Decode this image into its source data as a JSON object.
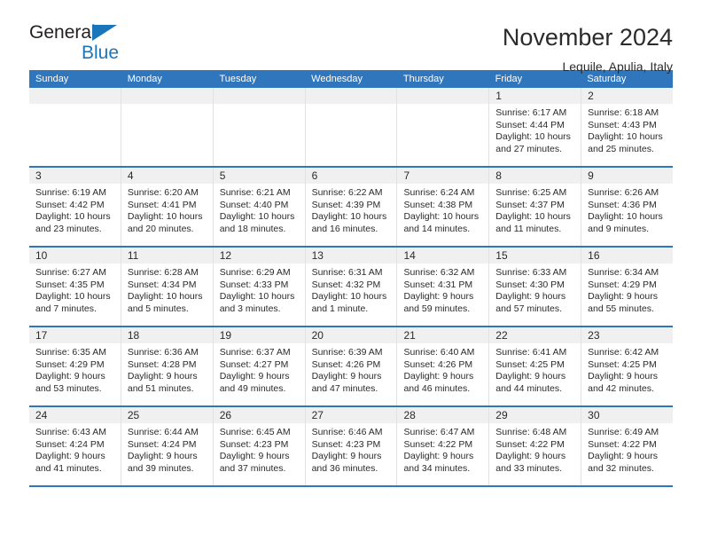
{
  "brand": {
    "name_part1": "General",
    "name_part2": "Blue",
    "accent_color": "#1b75bb"
  },
  "header": {
    "title": "November 2024",
    "location": "Lequile, Apulia, Italy"
  },
  "calendar": {
    "header_bg": "#2f76bc",
    "weekdays": [
      "Sunday",
      "Monday",
      "Tuesday",
      "Wednesday",
      "Thursday",
      "Friday",
      "Saturday"
    ],
    "weeks": [
      [
        {
          "day": "",
          "empty": true
        },
        {
          "day": "",
          "empty": true
        },
        {
          "day": "",
          "empty": true
        },
        {
          "day": "",
          "empty": true
        },
        {
          "day": "",
          "empty": true
        },
        {
          "day": "1",
          "sunrise": "Sunrise: 6:17 AM",
          "sunset": "Sunset: 4:44 PM",
          "daylight_line1": "Daylight: 10 hours",
          "daylight_line2": "and 27 minutes."
        },
        {
          "day": "2",
          "sunrise": "Sunrise: 6:18 AM",
          "sunset": "Sunset: 4:43 PM",
          "daylight_line1": "Daylight: 10 hours",
          "daylight_line2": "and 25 minutes."
        }
      ],
      [
        {
          "day": "3",
          "sunrise": "Sunrise: 6:19 AM",
          "sunset": "Sunset: 4:42 PM",
          "daylight_line1": "Daylight: 10 hours",
          "daylight_line2": "and 23 minutes."
        },
        {
          "day": "4",
          "sunrise": "Sunrise: 6:20 AM",
          "sunset": "Sunset: 4:41 PM",
          "daylight_line1": "Daylight: 10 hours",
          "daylight_line2": "and 20 minutes."
        },
        {
          "day": "5",
          "sunrise": "Sunrise: 6:21 AM",
          "sunset": "Sunset: 4:40 PM",
          "daylight_line1": "Daylight: 10 hours",
          "daylight_line2": "and 18 minutes."
        },
        {
          "day": "6",
          "sunrise": "Sunrise: 6:22 AM",
          "sunset": "Sunset: 4:39 PM",
          "daylight_line1": "Daylight: 10 hours",
          "daylight_line2": "and 16 minutes."
        },
        {
          "day": "7",
          "sunrise": "Sunrise: 6:24 AM",
          "sunset": "Sunset: 4:38 PM",
          "daylight_line1": "Daylight: 10 hours",
          "daylight_line2": "and 14 minutes."
        },
        {
          "day": "8",
          "sunrise": "Sunrise: 6:25 AM",
          "sunset": "Sunset: 4:37 PM",
          "daylight_line1": "Daylight: 10 hours",
          "daylight_line2": "and 11 minutes."
        },
        {
          "day": "9",
          "sunrise": "Sunrise: 6:26 AM",
          "sunset": "Sunset: 4:36 PM",
          "daylight_line1": "Daylight: 10 hours",
          "daylight_line2": "and 9 minutes."
        }
      ],
      [
        {
          "day": "10",
          "sunrise": "Sunrise: 6:27 AM",
          "sunset": "Sunset: 4:35 PM",
          "daylight_line1": "Daylight: 10 hours",
          "daylight_line2": "and 7 minutes."
        },
        {
          "day": "11",
          "sunrise": "Sunrise: 6:28 AM",
          "sunset": "Sunset: 4:34 PM",
          "daylight_line1": "Daylight: 10 hours",
          "daylight_line2": "and 5 minutes."
        },
        {
          "day": "12",
          "sunrise": "Sunrise: 6:29 AM",
          "sunset": "Sunset: 4:33 PM",
          "daylight_line1": "Daylight: 10 hours",
          "daylight_line2": "and 3 minutes."
        },
        {
          "day": "13",
          "sunrise": "Sunrise: 6:31 AM",
          "sunset": "Sunset: 4:32 PM",
          "daylight_line1": "Daylight: 10 hours",
          "daylight_line2": "and 1 minute."
        },
        {
          "day": "14",
          "sunrise": "Sunrise: 6:32 AM",
          "sunset": "Sunset: 4:31 PM",
          "daylight_line1": "Daylight: 9 hours",
          "daylight_line2": "and 59 minutes."
        },
        {
          "day": "15",
          "sunrise": "Sunrise: 6:33 AM",
          "sunset": "Sunset: 4:30 PM",
          "daylight_line1": "Daylight: 9 hours",
          "daylight_line2": "and 57 minutes."
        },
        {
          "day": "16",
          "sunrise": "Sunrise: 6:34 AM",
          "sunset": "Sunset: 4:29 PM",
          "daylight_line1": "Daylight: 9 hours",
          "daylight_line2": "and 55 minutes."
        }
      ],
      [
        {
          "day": "17",
          "sunrise": "Sunrise: 6:35 AM",
          "sunset": "Sunset: 4:29 PM",
          "daylight_line1": "Daylight: 9 hours",
          "daylight_line2": "and 53 minutes."
        },
        {
          "day": "18",
          "sunrise": "Sunrise: 6:36 AM",
          "sunset": "Sunset: 4:28 PM",
          "daylight_line1": "Daylight: 9 hours",
          "daylight_line2": "and 51 minutes."
        },
        {
          "day": "19",
          "sunrise": "Sunrise: 6:37 AM",
          "sunset": "Sunset: 4:27 PM",
          "daylight_line1": "Daylight: 9 hours",
          "daylight_line2": "and 49 minutes."
        },
        {
          "day": "20",
          "sunrise": "Sunrise: 6:39 AM",
          "sunset": "Sunset: 4:26 PM",
          "daylight_line1": "Daylight: 9 hours",
          "daylight_line2": "and 47 minutes."
        },
        {
          "day": "21",
          "sunrise": "Sunrise: 6:40 AM",
          "sunset": "Sunset: 4:26 PM",
          "daylight_line1": "Daylight: 9 hours",
          "daylight_line2": "and 46 minutes."
        },
        {
          "day": "22",
          "sunrise": "Sunrise: 6:41 AM",
          "sunset": "Sunset: 4:25 PM",
          "daylight_line1": "Daylight: 9 hours",
          "daylight_line2": "and 44 minutes."
        },
        {
          "day": "23",
          "sunrise": "Sunrise: 6:42 AM",
          "sunset": "Sunset: 4:25 PM",
          "daylight_line1": "Daylight: 9 hours",
          "daylight_line2": "and 42 minutes."
        }
      ],
      [
        {
          "day": "24",
          "sunrise": "Sunrise: 6:43 AM",
          "sunset": "Sunset: 4:24 PM",
          "daylight_line1": "Daylight: 9 hours",
          "daylight_line2": "and 41 minutes."
        },
        {
          "day": "25",
          "sunrise": "Sunrise: 6:44 AM",
          "sunset": "Sunset: 4:24 PM",
          "daylight_line1": "Daylight: 9 hours",
          "daylight_line2": "and 39 minutes."
        },
        {
          "day": "26",
          "sunrise": "Sunrise: 6:45 AM",
          "sunset": "Sunset: 4:23 PM",
          "daylight_line1": "Daylight: 9 hours",
          "daylight_line2": "and 37 minutes."
        },
        {
          "day": "27",
          "sunrise": "Sunrise: 6:46 AM",
          "sunset": "Sunset: 4:23 PM",
          "daylight_line1": "Daylight: 9 hours",
          "daylight_line2": "and 36 minutes."
        },
        {
          "day": "28",
          "sunrise": "Sunrise: 6:47 AM",
          "sunset": "Sunset: 4:22 PM",
          "daylight_line1": "Daylight: 9 hours",
          "daylight_line2": "and 34 minutes."
        },
        {
          "day": "29",
          "sunrise": "Sunrise: 6:48 AM",
          "sunset": "Sunset: 4:22 PM",
          "daylight_line1": "Daylight: 9 hours",
          "daylight_line2": "and 33 minutes."
        },
        {
          "day": "30",
          "sunrise": "Sunrise: 6:49 AM",
          "sunset": "Sunset: 4:22 PM",
          "daylight_line1": "Daylight: 9 hours",
          "daylight_line2": "and 32 minutes."
        }
      ]
    ]
  }
}
